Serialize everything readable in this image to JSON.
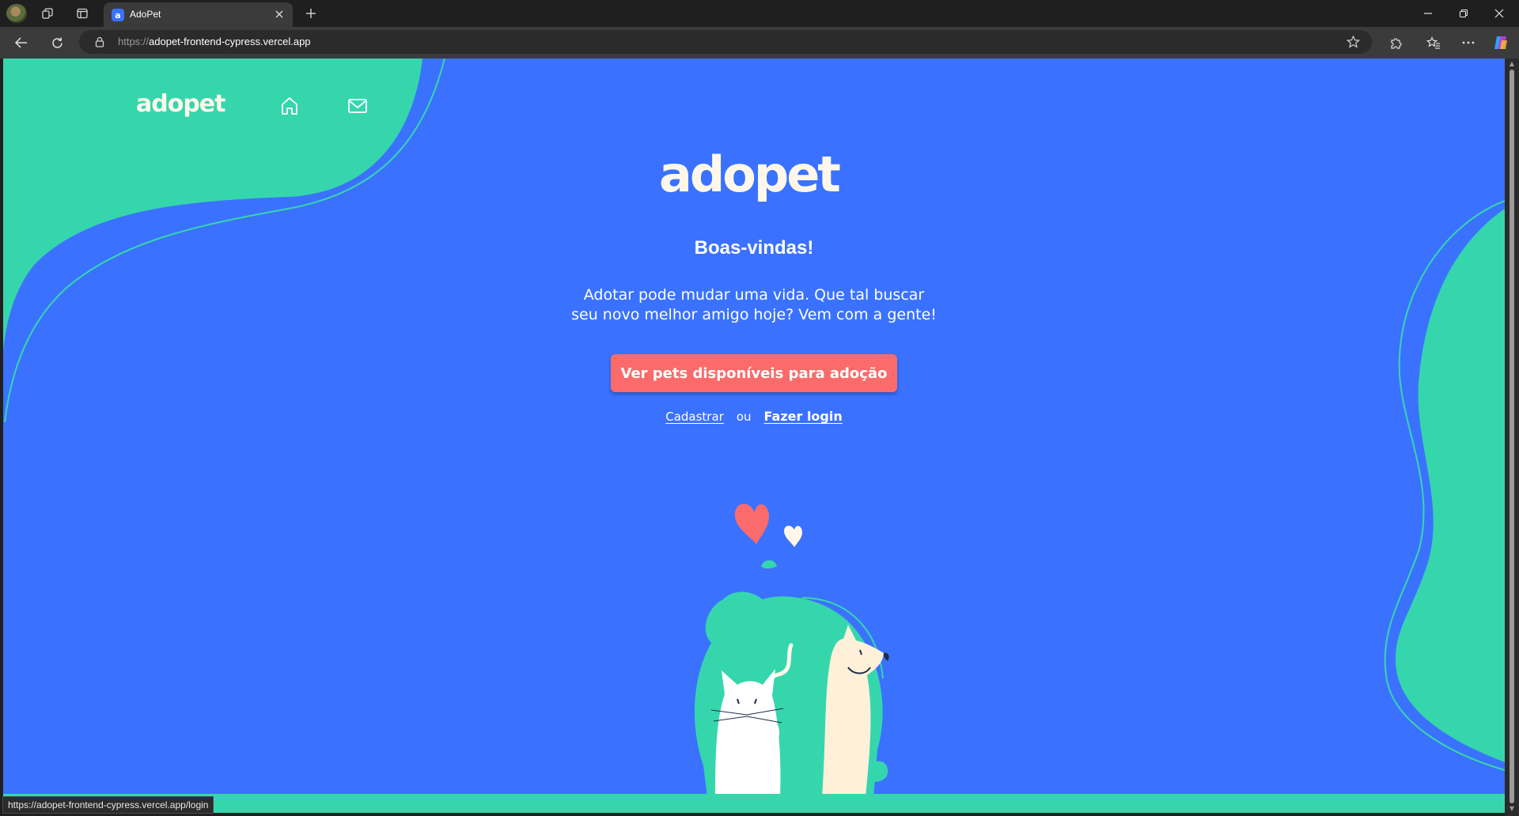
{
  "browser": {
    "tab_title": "AdoPet",
    "tab_favicon_letter": "a",
    "url_scheme": "https://",
    "url_host": "adopet-frontend-cypress.vercel.app",
    "status_url": "https://adopet-frontend-cypress.vercel.app/login"
  },
  "icons": {
    "profile": "profile-avatar-icon",
    "workspaces": "workspaces-icon",
    "tab_actions": "tab-actions-icon",
    "close_tab": "close-icon",
    "new_tab": "plus-icon",
    "minimize": "minimize-icon",
    "restore": "restore-icon",
    "close_window": "close-icon",
    "back": "back-arrow-icon",
    "reload": "reload-icon",
    "lock": "lock-icon",
    "favorite": "star-icon",
    "extensions": "puzzle-icon",
    "favorites": "favorites-icon",
    "more": "more-icon",
    "copilot": "copilot-icon",
    "home": "home-icon",
    "message": "mail-icon"
  },
  "site": {
    "nav_logo": "adopet",
    "hero_logo": "adopet",
    "title": "Boas-vindas!",
    "description": "Adotar pode mudar uma vida. Que tal buscar seu novo melhor amigo hoje? Vem com a gente!",
    "cta_label": "Ver pets disponíveis para adoção",
    "register_label": "Cadastrar",
    "or_label": "ou",
    "login_label": "Fazer login"
  },
  "colors": {
    "background_blue": "#3a72ff",
    "accent_green": "#36d6ad",
    "cta_coral": "#fc6b6b",
    "cream": "#fff8ea"
  }
}
